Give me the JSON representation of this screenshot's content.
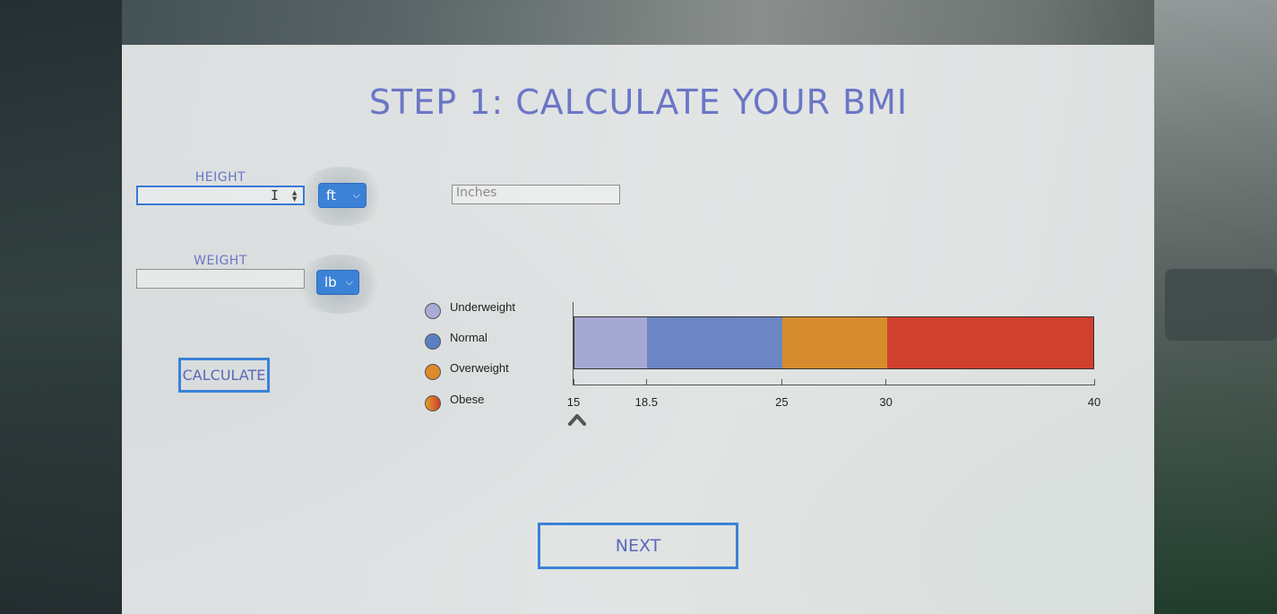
{
  "page": {
    "title": "STEP 1: CALCULATE YOUR BMI"
  },
  "height": {
    "label": "HEIGHT",
    "value": "",
    "unit": "ft",
    "inches_placeholder": "Inches"
  },
  "weight": {
    "label": "WEIGHT",
    "value": "",
    "unit": "lb"
  },
  "buttons": {
    "calculate": "CALCULATE",
    "next": "NEXT"
  },
  "legend": [
    {
      "label": "Underweight",
      "color": "#a9acd6"
    },
    {
      "label": "Normal",
      "color": "#5a80c4"
    },
    {
      "label": "Overweight",
      "color": "#de8a2a"
    },
    {
      "label": "Obese",
      "color": "#d43c2c"
    }
  ],
  "scale": {
    "min": 15,
    "max": 40,
    "ticks": [
      "15",
      "18.5",
      "25",
      "30",
      "40"
    ],
    "tick_values": [
      15,
      18.5,
      25,
      30,
      40
    ],
    "categories": [
      {
        "name": "Underweight",
        "from": 15,
        "to": 18.5,
        "color": "#a5a8d2"
      },
      {
        "name": "Normal",
        "from": 18.5,
        "to": 25,
        "color": "#6b86c2"
      },
      {
        "name": "Overweight",
        "from": 25,
        "to": 30,
        "color": "#d68c2c"
      },
      {
        "name": "Obese",
        "from": 30,
        "to": 40,
        "color": "#d0402e"
      }
    ],
    "pointer_value": 15
  },
  "icons": {
    "pointer": "chevron-up-icon",
    "select_arrow": "chevron-down-icon",
    "spinner": "spin-arrows-icon"
  }
}
